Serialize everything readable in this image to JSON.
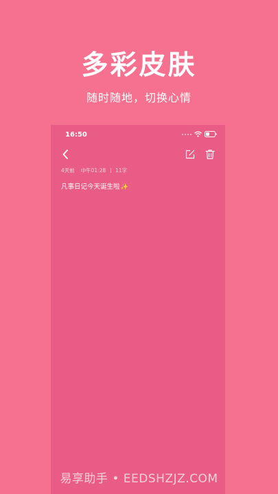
{
  "promo": {
    "title": "多彩皮肤",
    "subtitle": "随时随地，切换心情"
  },
  "status_bar": {
    "time": "16:50",
    "icons": [
      "signal-dots-icon",
      "wifi-icon",
      "battery-icon"
    ]
  },
  "nav": {
    "icons": [
      "back-chevron-icon",
      "edit-icon",
      "trash-icon"
    ]
  },
  "note": {
    "meta_ago": "4天前",
    "meta_time": "中午01:28",
    "meta_count": "11字",
    "body": "凡事日记今天诞生啦",
    "emoji": "✨"
  },
  "watermark": "易享助手 • EEDSHZJZ.COM",
  "colors": {
    "page_background": "#f5718f",
    "phone_background": "#e95c85",
    "text": "#ffffff"
  }
}
